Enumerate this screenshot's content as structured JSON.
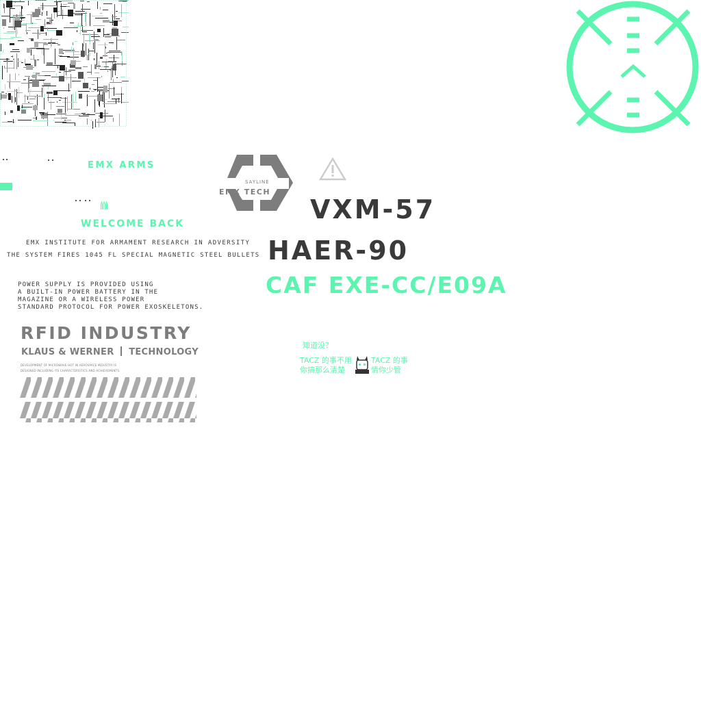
{
  "brand": {
    "emx_arms": "EMX ARMS",
    "welcome": "WELCOME BACK",
    "logo_small": "SAYLINE",
    "logo_main": "EMX TECH"
  },
  "info": {
    "institute": "EMX INSTITUTE FOR ARMAMENT RESEARCH IN ADVERSITY",
    "fires": "THE SYSTEM FIRES 1045 FL SPECIAL MAGNETIC STEEL BULLETS",
    "power_lines": [
      "POWER SUPPLY IS PROVIDED USING",
      "A BUILT-IN POWER BATTERY IN THE",
      "MAGAZINE OR A WIRELESS POWER",
      "STANDARD PROTOCOL FOR POWER EXOSKELETONS."
    ]
  },
  "rfid": {
    "title": "RFID INDUSTRY",
    "subtitle_left": "KLAUS & WERNER",
    "subtitle_right": "TECHNOLOGY",
    "fine_print": [
      "DEVELOPMENT OF MICROWAVE HOT IN AEROSPACE INDUSTRY IS",
      "DESIGNED INCLUDING ITS CHARACTERISTICS AND ACHIEVEMENTS."
    ]
  },
  "models": {
    "vxm": "VXM-57",
    "haer": "HAER-90",
    "caf": "CAF EXE-CC/E09A"
  },
  "meme": {
    "question": "知道没？",
    "left_line1": "TACZ 的事不用",
    "left_line2": "你搞那么清楚",
    "right_line1": "TACZ 的事",
    "right_line2": "情你少管"
  },
  "colors": {
    "accent": "#5cf5b0",
    "dark": "#3a3a3a",
    "grey": "#7d7d7d"
  },
  "icons": [
    "warning-icon",
    "reticle-icon",
    "emx-tech-logo",
    "circuit-pattern",
    "bullet-icon",
    "avatar-icon"
  ]
}
